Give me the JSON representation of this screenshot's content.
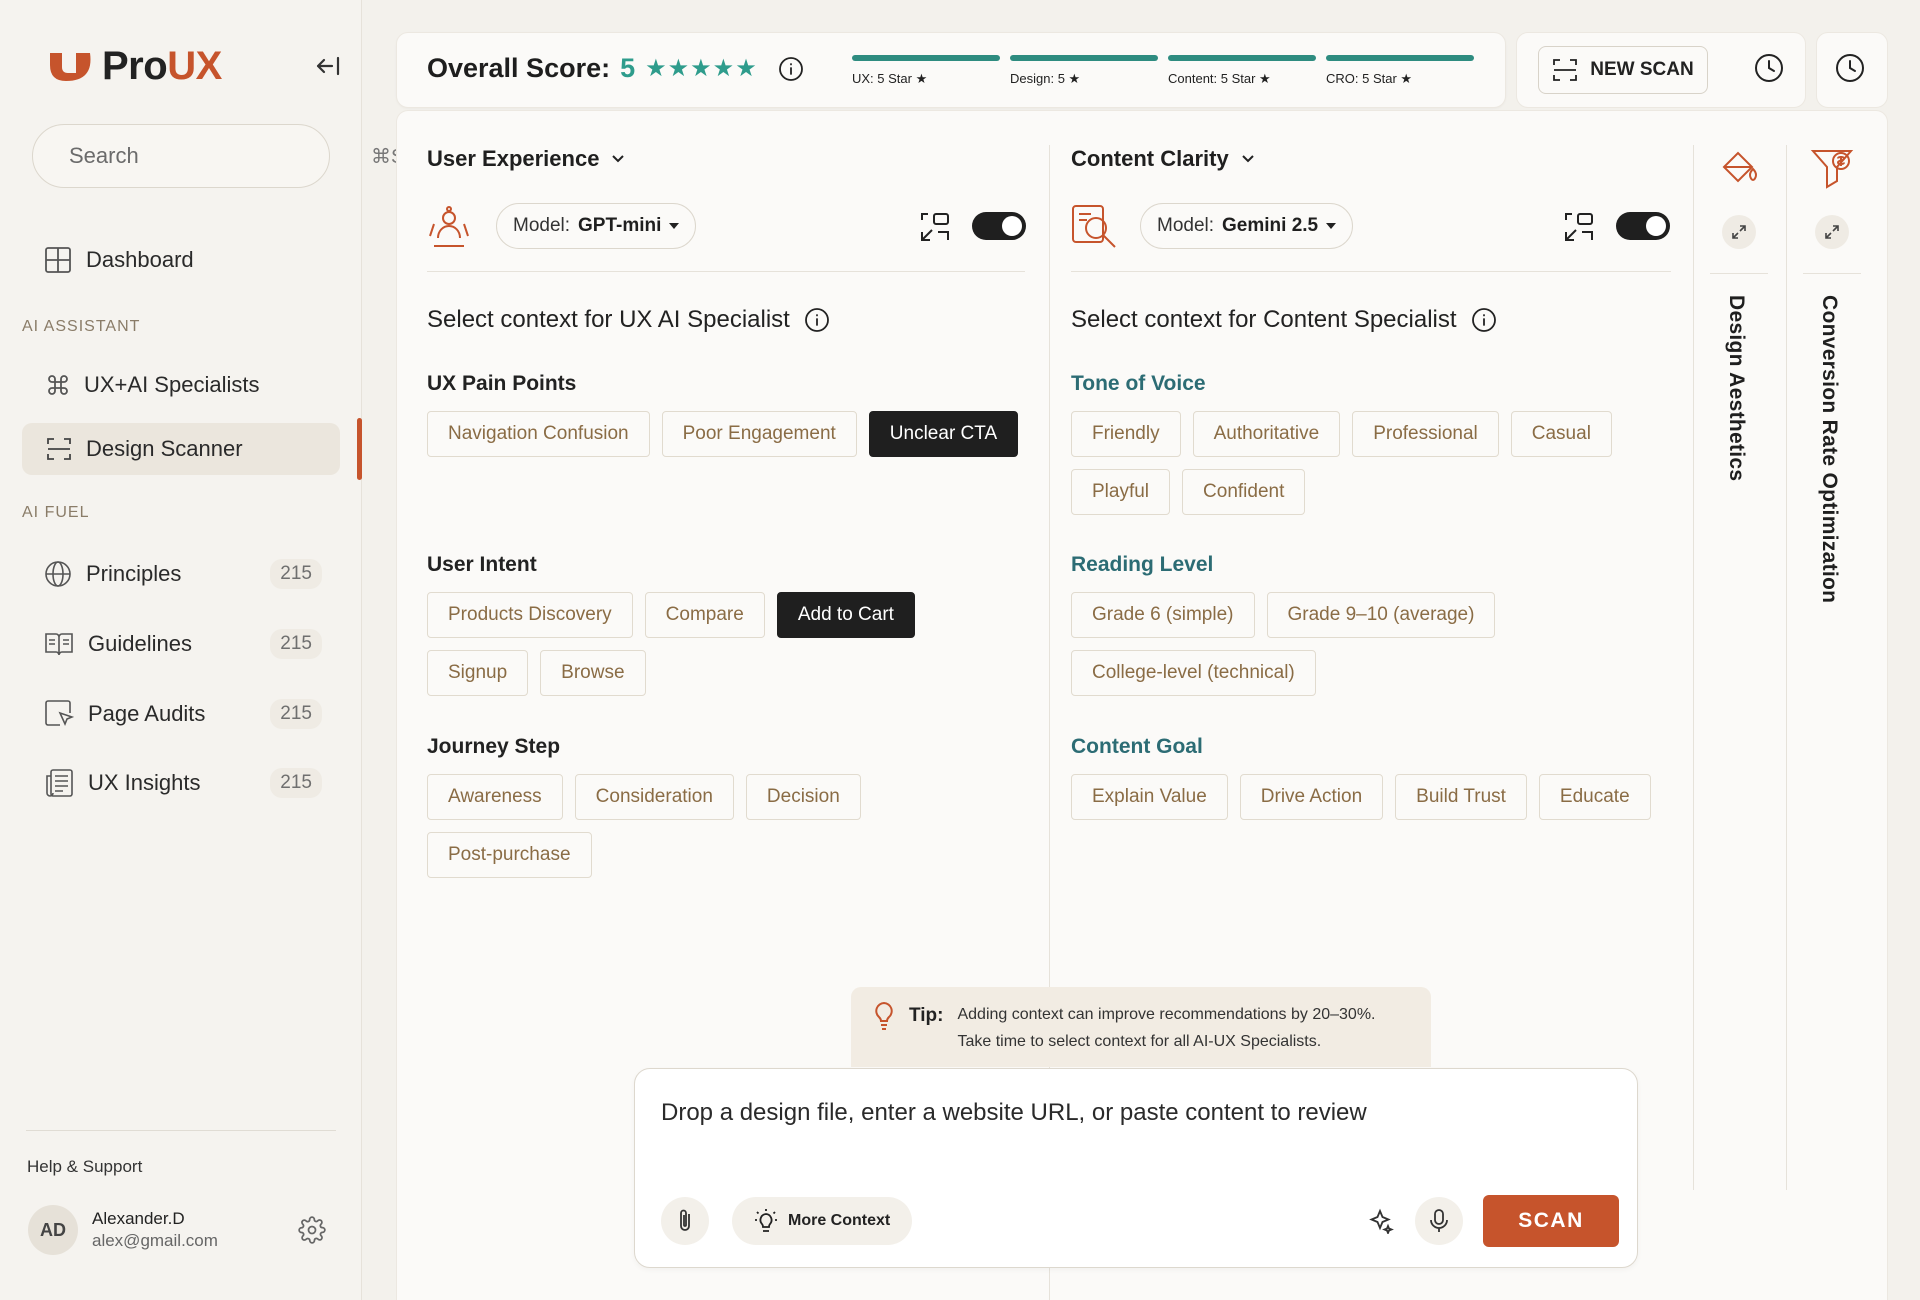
{
  "brand": {
    "name_pro": "Pro",
    "name_ux": "UX",
    "accent": "#c6542c"
  },
  "search": {
    "placeholder": "Search",
    "shortcut": "⌘S"
  },
  "nav": {
    "dashboard": "Dashboard",
    "section_ai_assistant": "AI ASSISTANT",
    "ux_ai_specialists": "UX+AI Specialists",
    "design_scanner": "Design Scanner",
    "section_ai_fuel": "AI FUEL",
    "fuel_items": [
      {
        "label": "Principles",
        "count": "215"
      },
      {
        "label": "Guidelines",
        "count": "215"
      },
      {
        "label": "Page Audits",
        "count": "215"
      },
      {
        "label": "UX Insights",
        "count": "215"
      }
    ]
  },
  "footer": {
    "help": "Help & Support",
    "user_initials": "AD",
    "user_name": "Alexander.D",
    "user_email": "alex@gmail.com"
  },
  "topbar": {
    "overall_label": "Overall Score:",
    "overall_score": "5",
    "stars": "★★★★★",
    "score_bars": [
      {
        "label": "UX: 5 Star ★",
        "value": 1.0
      },
      {
        "label": "Design: 5 ★",
        "value": 1.0
      },
      {
        "label": "Content: 5 Star ★",
        "value": 1.0
      },
      {
        "label": "CRO: 5 Star ★",
        "value": 1.0
      }
    ],
    "new_scan": "NEW SCAN",
    "score_color": "#2e9c8c"
  },
  "ux_panel": {
    "title": "User Experience",
    "model_label": "Model:",
    "model_value": "GPT-mini",
    "toggle_on": true,
    "context_heading": "Select context for UX AI Specialist",
    "groups": [
      {
        "title": "UX Pain Points",
        "chips": [
          "Navigation Confusion",
          "Poor Engagement",
          "Unclear CTA"
        ],
        "selected": [
          "Unclear CTA"
        ]
      },
      {
        "title": "User Intent",
        "chips": [
          "Products Discovery",
          "Compare",
          "Add to Cart",
          "Signup",
          "Browse"
        ],
        "selected": [
          "Add to Cart"
        ]
      },
      {
        "title": "Journey Step",
        "chips": [
          "Awareness",
          "Consideration",
          "Decision",
          "Post-purchase"
        ],
        "selected": []
      }
    ]
  },
  "content_panel": {
    "title": "Content Clarity",
    "model_label": "Model:",
    "model_value": "Gemini 2.5",
    "toggle_on": true,
    "context_heading": "Select context for Content Specialist",
    "groups": [
      {
        "title": "Tone of Voice",
        "chips": [
          "Friendly",
          "Authoritative",
          "Professional",
          "Casual",
          "Playful",
          "Confident"
        ],
        "selected": []
      },
      {
        "title": "Reading Level",
        "chips": [
          "Grade 6 (simple)",
          "Grade 9–10 (average)",
          "College-level (technical)"
        ],
        "selected": []
      },
      {
        "title": "Content Goal",
        "chips": [
          "Explain Value",
          "Drive Action",
          "Build Trust",
          "Educate"
        ],
        "selected": []
      }
    ]
  },
  "side_panels": [
    {
      "label": "Design Aesthetics",
      "icon": "paint-bucket-icon"
    },
    {
      "label": "Conversion Rate Optimization",
      "icon": "dollar-funnel-icon"
    }
  ],
  "tip": {
    "label": "Tip:",
    "line1": "Adding context can improve recommendations by 20–30%.",
    "line2": "Take time to select context for all AI-UX Specialists."
  },
  "composer": {
    "placeholder": "Drop a design file, enter a website URL, or paste content to review",
    "more_context": "More Context",
    "scan": "SCAN"
  }
}
